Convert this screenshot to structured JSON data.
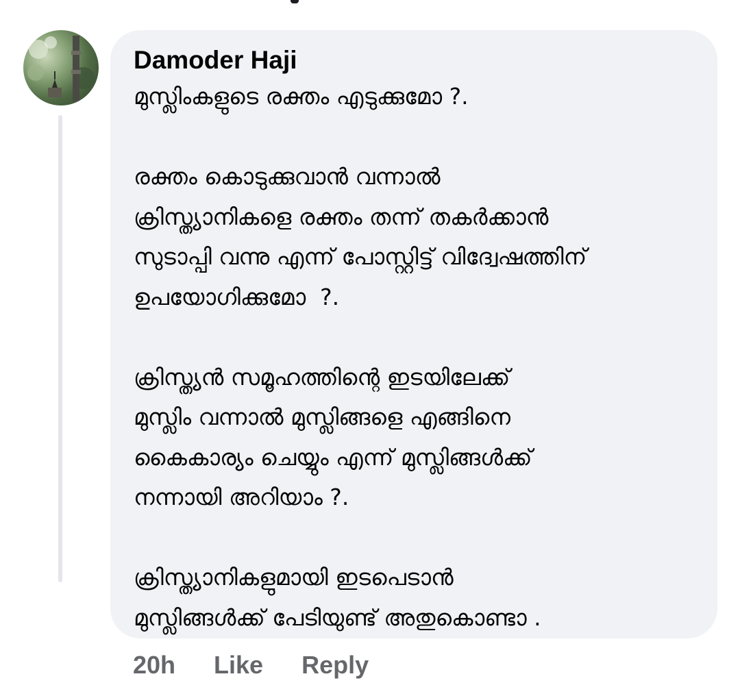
{
  "comment": {
    "author": "Damoder Haji",
    "text": "മുസ്ലിംകളുടെ രക്തം എടുക്കുമോ ?.\n\nരക്തം കൊടുക്കുവാൻ വന്നാൽ\nക്രിസ്ത്യാനികളെ രക്തം തന്ന് തകർക്കാൻ\nസുടാപ്പി വന്നു എന്ന് പോസ്റ്റിട്ട് വിദ്വേഷത്തിന്\nഉപയോഗിക്കുമോ  ?.\n\nക്രിസ്ത്യൻ സമൂഹത്തിന്റെ ഇടയിലേക്ക്\nമുസ്ലിം വന്നാൽ മുസ്ലിങ്ങളെ എങ്ങിനെ\nകൈകാര്യം ചെയ്യും എന്ന് മുസ്ലിങ്ങൾക്ക്\nനന്നായി അറിയാം ?.\n\nക്രിസ്ത്യാനികളുമായി ഇടപെടാൻ\nമുസ്ലിങ്ങൾക്ക് പേടിയുണ്ട് അതുകൊണ്ടാ .",
    "timestamp": "20h",
    "like_label": "Like",
    "reply_label": "Reply"
  },
  "colors": {
    "bubble_bg": "#f0f2f5",
    "text": "#050505",
    "meta_text": "#65676b",
    "thread_line": "#e4e6eb"
  }
}
